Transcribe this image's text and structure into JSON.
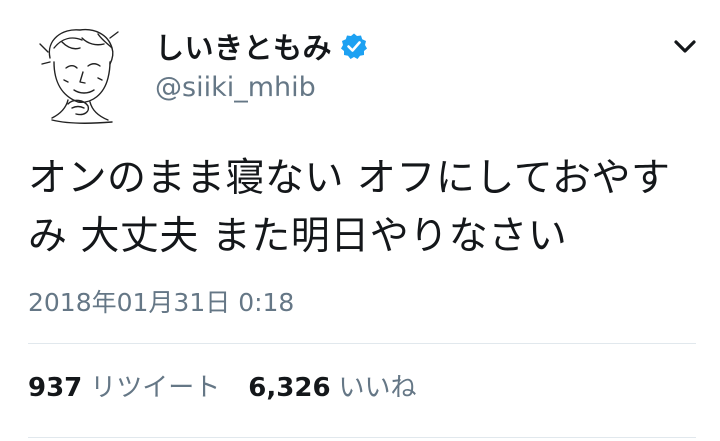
{
  "user": {
    "display_name": "しいきともみ",
    "handle": "@siiki_mhib",
    "verified": true,
    "avatar_icon": "sketch-portrait-avatar"
  },
  "tweet": {
    "text": "オンのまま寝ない オフにしておやすみ 大丈夫 また明日やりなさい",
    "timestamp": "2018年01月31日 0:18"
  },
  "stats": {
    "retweets_count": "937",
    "retweets_label": "リツイート",
    "likes_count": "6,326",
    "likes_label": "いいね"
  },
  "icons": {
    "verified": "verified-badge-icon",
    "menu": "chevron-down-icon"
  },
  "colors": {
    "verified_blue": "#1da1f2",
    "secondary_text": "#657786",
    "primary_text": "#14171a"
  }
}
